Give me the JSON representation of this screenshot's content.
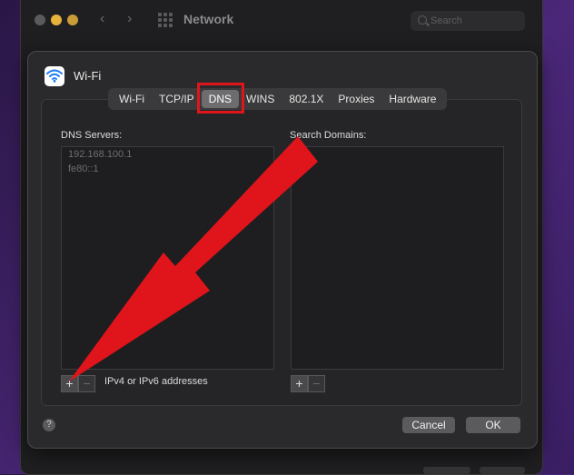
{
  "window": {
    "title": "Network",
    "search_placeholder": "Search"
  },
  "sheet": {
    "interface_name": "Wi-Fi",
    "tabs": [
      {
        "label": "Wi-Fi"
      },
      {
        "label": "TCP/IP"
      },
      {
        "label": "DNS",
        "active": true
      },
      {
        "label": "WINS"
      },
      {
        "label": "802.1X"
      },
      {
        "label": "Proxies"
      },
      {
        "label": "Hardware"
      }
    ],
    "dns": {
      "servers_label": "DNS Servers:",
      "servers": [
        "192.168.100.1",
        "fe80::1"
      ],
      "hint": "IPv4 or IPv6 addresses"
    },
    "search": {
      "label": "Search Domains:",
      "domains": []
    },
    "plus_symbol": "+",
    "minus_symbol": "−",
    "help_symbol": "?",
    "cancel_label": "Cancel",
    "ok_label": "OK"
  },
  "colors": {
    "annotation_red": "#e0151b",
    "active_tab": "#6d6d70",
    "sheet_bg": "#2a2a2c"
  },
  "icons": {
    "interface": "wifi-icon",
    "annotation": "arrow-icon"
  }
}
